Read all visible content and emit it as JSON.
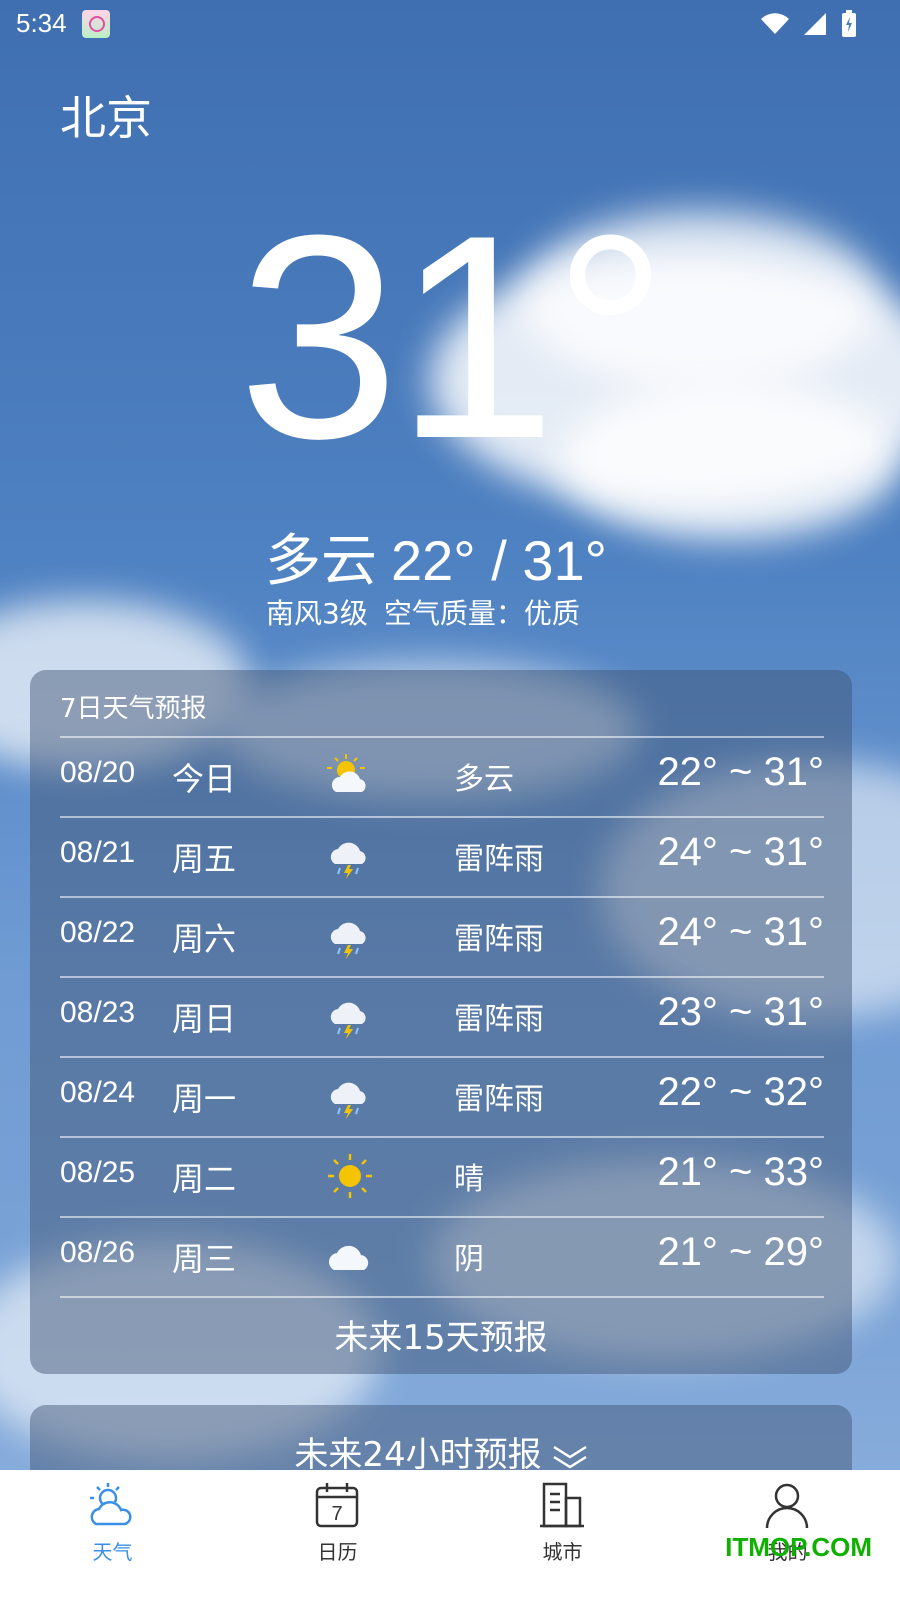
{
  "status_bar": {
    "time": "5:34"
  },
  "city": "北京",
  "current": {
    "temperature": "31°",
    "condition": "多云",
    "range": "22° / 31°",
    "wind": "南风3级",
    "air_quality": "空气质量：优质"
  },
  "forecast": {
    "title": "7日天气预报",
    "days": [
      {
        "date": "08/20",
        "day": "今日",
        "icon": "partly-cloudy-icon",
        "condition": "多云",
        "range": "22° ~ 31°"
      },
      {
        "date": "08/21",
        "day": "周五",
        "icon": "thunderstorm-icon",
        "condition": "雷阵雨",
        "range": "24° ~ 31°"
      },
      {
        "date": "08/22",
        "day": "周六",
        "icon": "thunderstorm-icon",
        "condition": "雷阵雨",
        "range": "24° ~ 31°"
      },
      {
        "date": "08/23",
        "day": "周日",
        "icon": "thunderstorm-icon",
        "condition": "雷阵雨",
        "range": "23° ~ 31°"
      },
      {
        "date": "08/24",
        "day": "周一",
        "icon": "thunderstorm-icon",
        "condition": "雷阵雨",
        "range": "22° ~ 32°"
      },
      {
        "date": "08/25",
        "day": "周二",
        "icon": "sunny-icon",
        "condition": "晴",
        "range": "21° ~ 33°"
      },
      {
        "date": "08/26",
        "day": "周三",
        "icon": "overcast-icon",
        "condition": "阴",
        "range": "21° ~ 29°"
      }
    ],
    "more_label": "未来15天预报"
  },
  "hourly": {
    "label": "未来24小时预报"
  },
  "nav": [
    {
      "label": "天气",
      "icon": "weather-icon",
      "active": true
    },
    {
      "label": "日历",
      "icon": "calendar-icon",
      "icon_text": "7",
      "active": false
    },
    {
      "label": "城市",
      "icon": "city-icon",
      "active": false
    },
    {
      "label": "我的",
      "icon": "person-icon",
      "active": false
    }
  ],
  "watermark": "ITMOP.COM",
  "colors": {
    "accent": "#3a8fe6",
    "watermark": "#0fb000"
  }
}
